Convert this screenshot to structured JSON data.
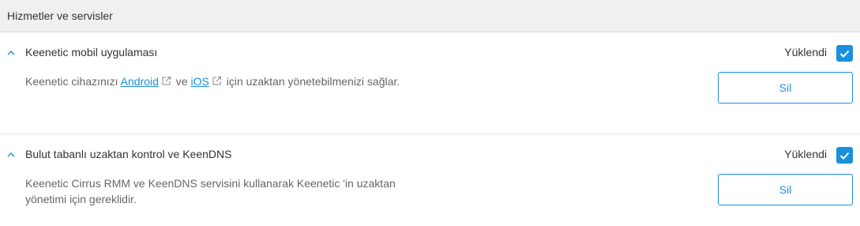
{
  "section": {
    "title": "Hizmetler ve servisler"
  },
  "items": [
    {
      "title": "Keenetic mobil uygulaması",
      "status": "Yüklendi",
      "checked": true,
      "desc_prefix": "Keenetic cihazınızı ",
      "link1": "Android",
      "desc_middle": " ve ",
      "link2": "iOS",
      "desc_suffix": " için uzaktan yönetebilmenizi sağlar.",
      "button": "Sil"
    },
    {
      "title": "Bulut tabanlı uzaktan kontrol ve KeenDNS",
      "status": "Yüklendi",
      "checked": true,
      "desc_line1": "Keenetic Cirrus RMM ve KeenDNS servisini kullanarak Keenetic 'in uzaktan",
      "desc_line2": "yönetimi için gereklidir.",
      "button": "Sil"
    }
  ],
  "colors": {
    "accent": "#1a8fdd",
    "header_bg": "#f0f0f0",
    "text": "#333333",
    "muted": "#666666"
  },
  "icons": {
    "collapse": "chevron-up-icon",
    "external": "external-link-icon",
    "check": "checkmark-icon"
  }
}
